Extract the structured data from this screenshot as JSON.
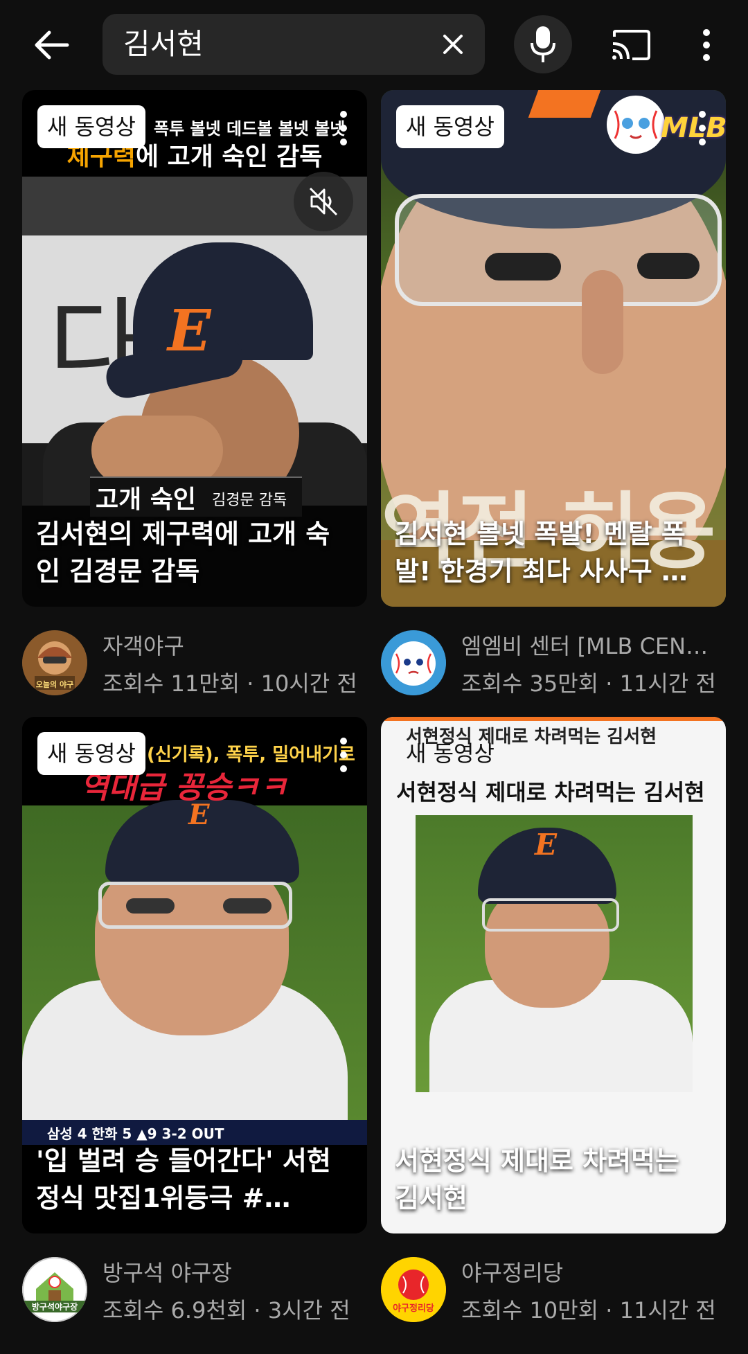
{
  "search": {
    "query": "김서현"
  },
  "videos": [
    {
      "badge": "새 동영상",
      "title": "김서현의 제구력에 고개 숙인 김경문 감독",
      "overlay_top_line1": "폭투 볼넷 데드볼 볼넷 볼넷",
      "overlay_top_line2_a": "제구력",
      "overlay_top_line2_b": "에 고개 숙인 감독",
      "overlay_caption": "고개 숙인",
      "overlay_caption_small": "김경문 감독",
      "bg_wall_text": "다",
      "cap_letter": "E",
      "channel": "자객야구",
      "stats": "조회수 11만회 · 10시간 전",
      "avatar_label": "오늘의 야구"
    },
    {
      "badge": "새 동영상",
      "title": "김서현 볼넷 폭발! 멘탈 폭발! 한경기 최다 사사구 …",
      "overlay_logo": "MLB",
      "overlay_bottom": "역전 허용",
      "channel": "엠엠비 센터 [MLB CEN…",
      "stats": "조회수 35만회 · 11시간 전"
    },
    {
      "badge": "새 동영상",
      "title": "'입 벌려 승 들어간다' 서현정식 맛집1위등극 #…",
      "overlay_top_line1": "(신기록), 폭투, 밀어내기로",
      "overlay_top_line2": "역대급 꽁승ㅋㅋ",
      "cap_letter": "E",
      "scoreboard": "삼성 4 한화 5 ▲9 3-2 OUT",
      "channel": "방구석 야구장",
      "stats": "조회수 6.9천회 · 3시간 전",
      "avatar_label": "방구석야구장"
    },
    {
      "badge": "새 동영상",
      "title": "서현정식 제대로 차려먹는 김서현",
      "overlay_top_line1": "서현정식 제대로 차려먹는 김서현",
      "overlay_heading": "서현정식 제대로 차려먹는 김서현",
      "cap_letter": "E",
      "channel": "야구정리당",
      "stats": "조회수 10만회 · 11시간 전",
      "avatar_label": "야구정리당"
    }
  ],
  "colors": {
    "background": "#0f0f0f",
    "chip": "#272727",
    "meta_text": "#aaaaaa",
    "accent_orange": "#f37321"
  }
}
